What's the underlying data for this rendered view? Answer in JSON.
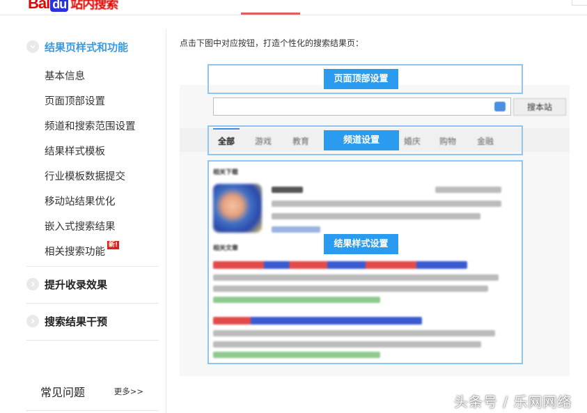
{
  "header": {
    "logo_text": "Bai",
    "logo_paw": "du",
    "logo_sub": "站内搜索"
  },
  "sidebar": {
    "sections": [
      {
        "title": "结果页样式和功能",
        "items": [
          "基本信息",
          "页面顶部设置",
          "频道和搜索范围设置",
          "结果样式模板",
          "行业模板数据提交",
          "移动站结果优化",
          "嵌入式搜索结果",
          "相关搜索功能"
        ]
      },
      {
        "title": "提升收录效果"
      },
      {
        "title": "搜索结果干预"
      }
    ],
    "new_badge": "新!",
    "faq_title": "常见问题",
    "faq_more": "更多>>"
  },
  "main": {
    "intro": "点击下图中对应按钮，打造个性化的搜索结果页：",
    "buttons": {
      "header_settings": "页面顶部设置",
      "channel_settings": "频道设置",
      "result_style_settings": "结果样式设置"
    },
    "search_button": "搜本站",
    "tabs": [
      "全部",
      "游戏",
      "教育",
      "婚庆",
      "购物",
      "金融"
    ],
    "results": {
      "related_download": "相关下载",
      "related_articles": "相关文章"
    }
  },
  "watermark": "头条号 / 乐网网络",
  "colors": {
    "accent": "#2a9bee",
    "frame": "#8ec5f2",
    "active_section": "#3b9ae1",
    "logo_red": "#e10601"
  }
}
